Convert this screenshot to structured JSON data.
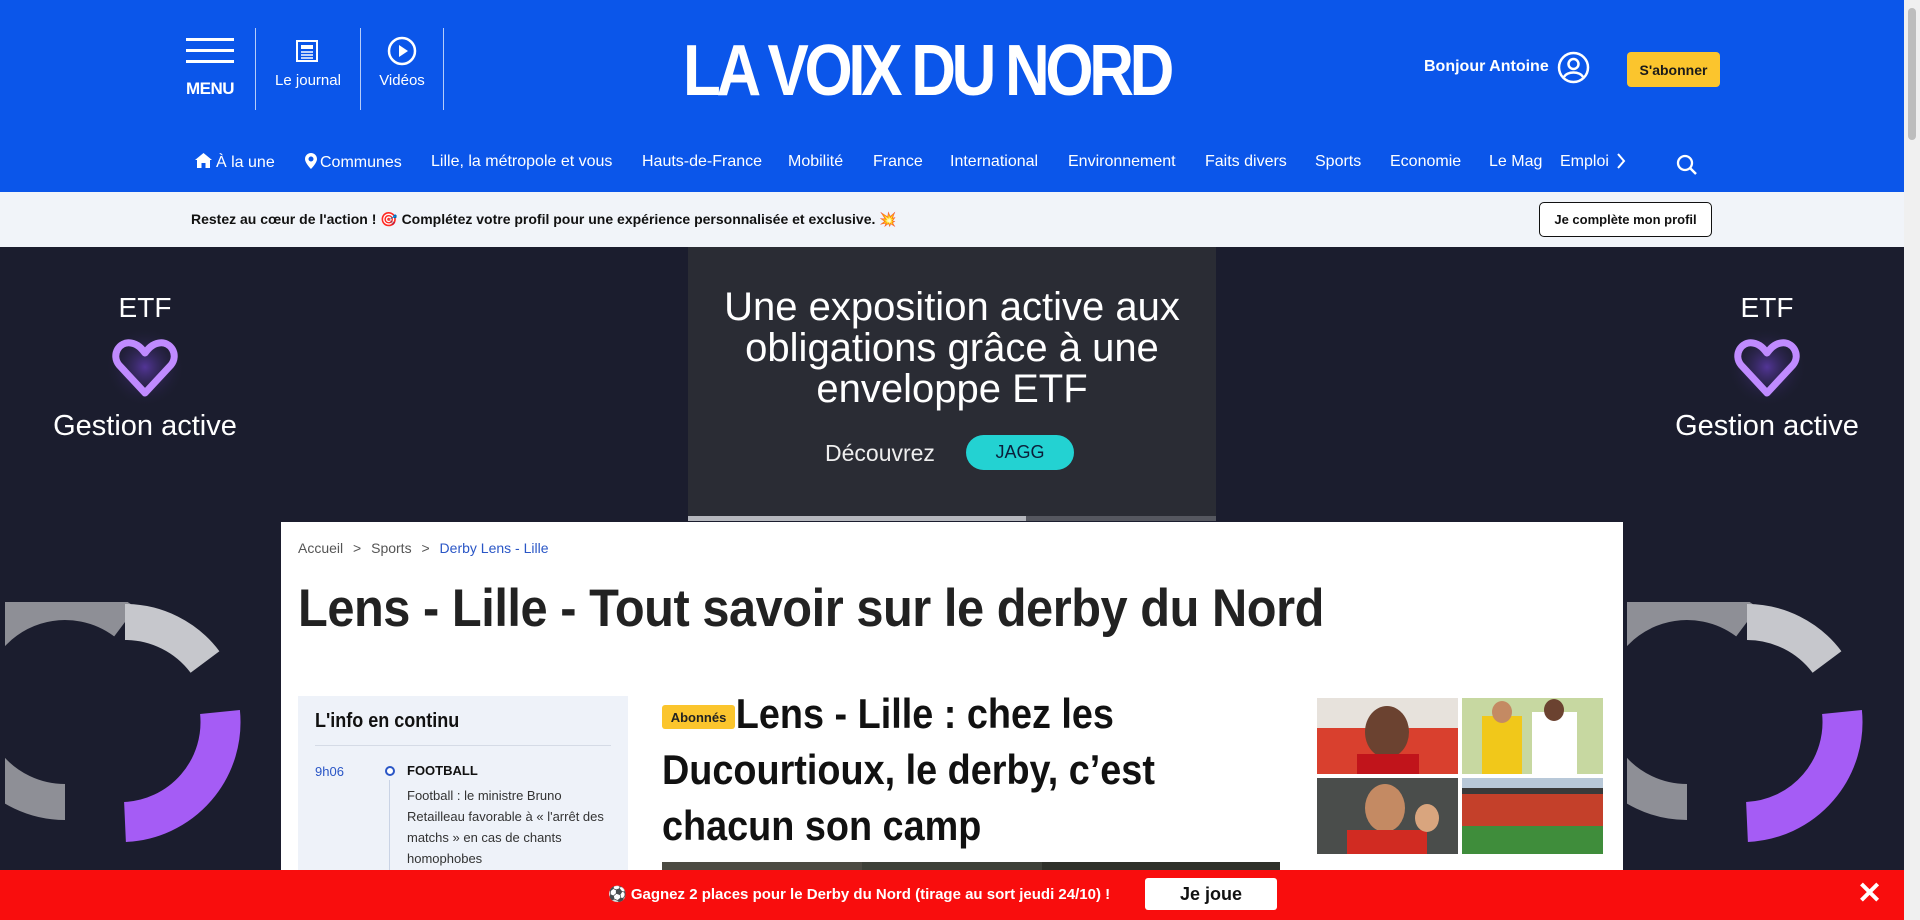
{
  "header": {
    "menu_label": "MENU",
    "journal_label": "Le journal",
    "videos_label": "Vidéos",
    "logo": "LA VOIX DU NORD",
    "greeting": "Bonjour Antoine",
    "subscribe_label": "S'abonner"
  },
  "nav": {
    "items": [
      "À la une",
      "Communes",
      "Lille, la métropole et vous",
      "Hauts-de-France",
      "Mobilité",
      "France",
      "International",
      "Environnement",
      "Faits divers",
      "Sports",
      "Economie",
      "Le Mag"
    ],
    "clipped": "Emploi"
  },
  "profile_strip": {
    "text": "Restez au cœur de l'action ! 🎯 Complétez votre profil pour une expérience personnalisée et exclusive. 💥",
    "button": "Je complète mon profil"
  },
  "ads": {
    "side_top": "ETF",
    "side_bottom": "Gestion active",
    "banner_headline": "Une exposition active aux obligations grâce à une enveloppe ETF",
    "banner_discover": "Découvrez",
    "banner_brand": "JAGG",
    "banner_progress": 0.64
  },
  "breadcrumb": {
    "home": "Accueil",
    "sep": ">",
    "section": "Sports",
    "current": "Derby Lens - Lille"
  },
  "page_title": "Lens - Lille - Tout savoir sur le derby du Nord",
  "ticker": {
    "title": "L'info en continu",
    "time": "9h06",
    "category": "FOOTBALL",
    "text": "Football : le ministre Bruno Retailleau favorable à « l'arrêt des matchs » en cas de chants homophobes"
  },
  "article": {
    "badge": "Abonnés",
    "title": "Lens - Lille : chez les Ducourtioux, le derby, c’est chacun son camp"
  },
  "promo": {
    "message": "⚽ Gagnez 2 places pour le Derby du Nord (tirage au sort jeudi 24/10) !",
    "button": "Je joue",
    "close": "✕"
  },
  "colors": {
    "brand_blue": "#0b56ea",
    "accent_yellow": "#fbc52d",
    "promo_red": "#f90d0d",
    "link_blue": "#2a56c6"
  }
}
